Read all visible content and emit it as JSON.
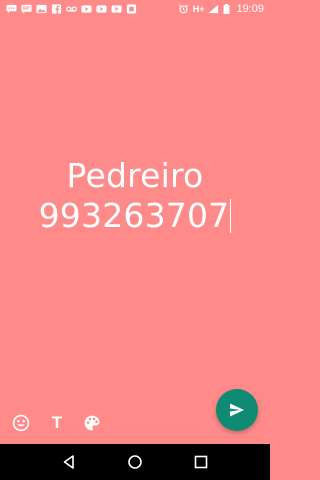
{
  "status_bar": {
    "network_type": "H+",
    "clock": "19:09",
    "notification_icons": [
      "chat-icon",
      "message-icon",
      "image-icon",
      "facebook-icon",
      "voicemail-icon",
      "youtube-icon",
      "youtube-icon",
      "youtube-icon",
      "app-icon"
    ],
    "system_icons": [
      "alarm-icon",
      "signal-icon",
      "battery-icon"
    ]
  },
  "editor": {
    "background_color": "#ff8a8a",
    "text_color": "#ffffff",
    "lines": [
      "Pedreiro",
      "993263707"
    ]
  },
  "toolbar": {
    "emoji_icon": "emoji-icon",
    "text_tool_label": "T",
    "palette_icon": "palette-icon"
  },
  "send_button": {
    "icon": "send-icon",
    "color": "#0f8a73"
  },
  "navigation": {
    "back_icon": "back-icon",
    "home_icon": "home-icon",
    "recents_icon": "recents-icon"
  }
}
